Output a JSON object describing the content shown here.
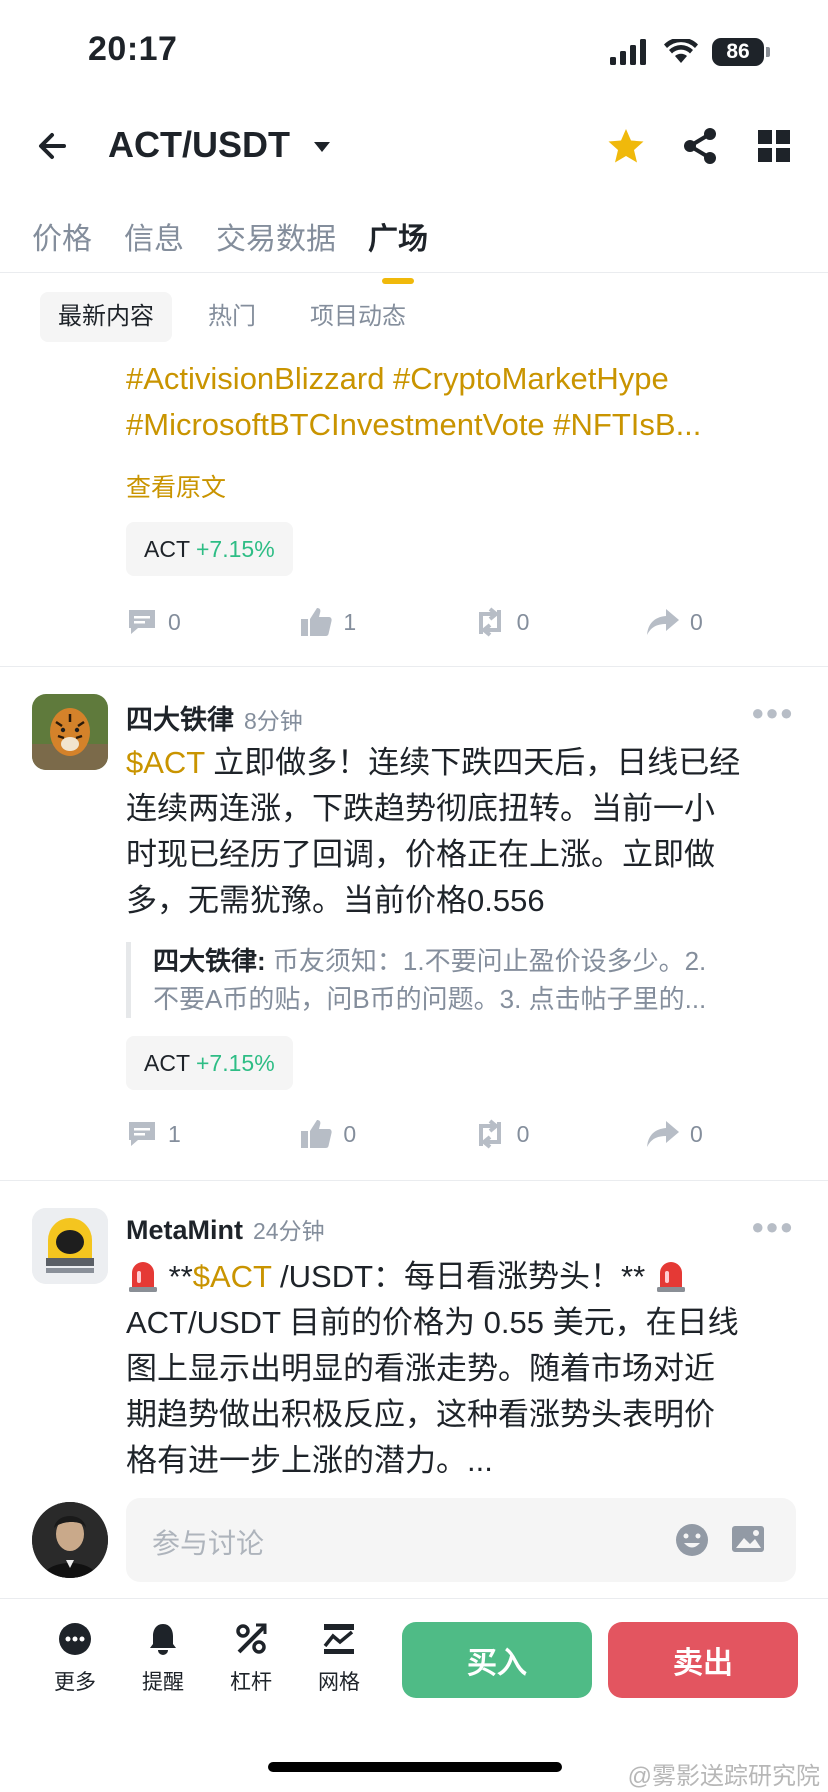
{
  "status_bar": {
    "time": "20:17",
    "battery": "86"
  },
  "header": {
    "pair": "ACT/USDT"
  },
  "tabs": [
    {
      "label": "价格",
      "active": false
    },
    {
      "label": "信息",
      "active": false
    },
    {
      "label": "交易数据",
      "active": false
    },
    {
      "label": "广场",
      "active": true
    }
  ],
  "subtabs": [
    {
      "label": "最新内容",
      "active": true
    },
    {
      "label": "热门",
      "active": false
    },
    {
      "label": "项目动态",
      "active": false
    }
  ],
  "post0": {
    "hashtags_line1": "#ActivisionBlizzard #CryptoMarketHype",
    "hashtags_line2": "#MicrosoftBTCInvestmentVote #NFTIsB...",
    "view_original": "查看原文",
    "chip": {
      "symbol": "ACT",
      "change": "+7.15%"
    },
    "actions": {
      "comments": "0",
      "likes": "1",
      "reposts": "0",
      "shares": "0"
    }
  },
  "post1": {
    "author": "四大铁律",
    "time": "8分钟",
    "ticker": "$ACT",
    "body_line1": " 立即做多！连续下跌四天后，日线已经",
    "body_line2": "连续两连涨，下跌趋势彻底扭转。当前一小",
    "body_line3": "时现已经历了回调，价格正在上涨。立即做",
    "body_line4": "多，无需犹豫。当前价格0.556",
    "quote_author": "四大铁律:",
    "quote_line1": " 币友须知：1.不要问止盈价设多少。2.",
    "quote_line2": "不要A币的贴，问B币的问题。3. 点击帖子里的...",
    "chip": {
      "symbol": "ACT",
      "change": "+7.15%"
    },
    "actions": {
      "comments": "1",
      "likes": "0",
      "reposts": "0",
      "shares": "0"
    }
  },
  "post2": {
    "author": "MetaMint",
    "time": "24分钟",
    "line1_pre": " **",
    "ticker": "$ACT",
    "line1_post": " /USDT：每日看涨势头！** ",
    "body_line2": "ACT/USDT 目前的价格为 0.55 美元，在日线",
    "body_line3": "图上显示出明显的看涨走势。随着市场对近",
    "body_line4": "期趋势做出积极反应，这种看涨势头表明价",
    "body_line5": "格有进一步上涨的潜力。..."
  },
  "comment": {
    "placeholder": "参与讨论"
  },
  "bottom_bar": {
    "tools": [
      {
        "label": "更多",
        "icon": "more-icon"
      },
      {
        "label": "提醒",
        "icon": "bell-icon"
      },
      {
        "label": "杠杆",
        "icon": "leverage-icon"
      },
      {
        "label": "网格",
        "icon": "grid-trading-icon"
      }
    ],
    "buy": "买入",
    "sell": "卖出"
  },
  "watermark": "@雾影送踪研究院",
  "colors": {
    "accent": "#F0B90B",
    "gold_text": "#C99400",
    "up": "#2EBD85",
    "buy": "#4FBB86",
    "sell": "#E35560"
  }
}
